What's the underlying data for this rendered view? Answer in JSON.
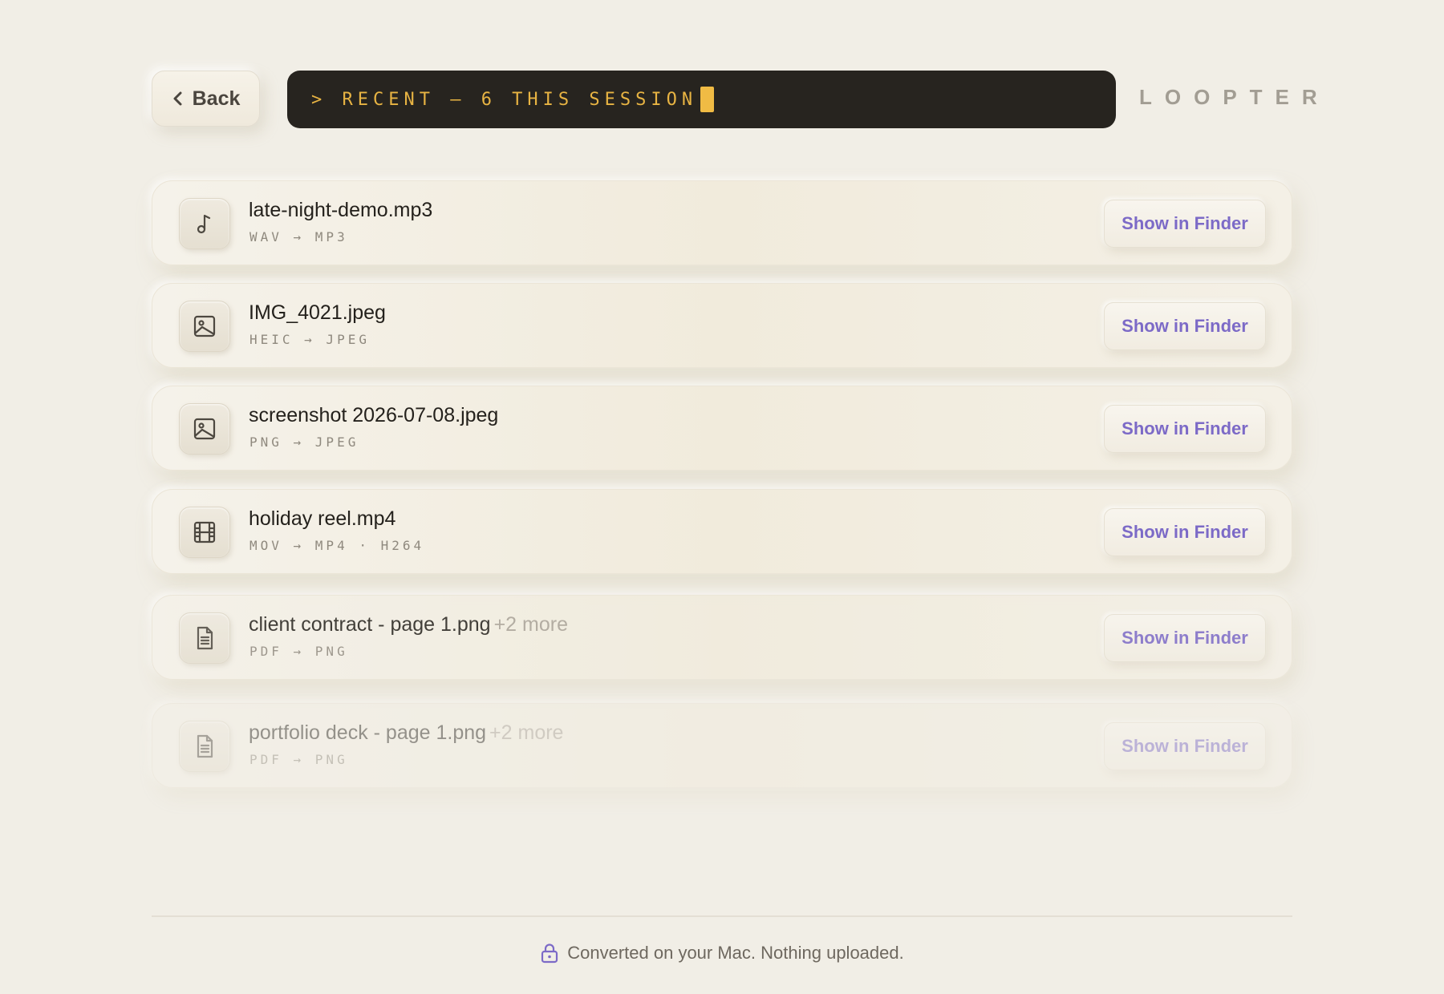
{
  "header": {
    "back_label": "Back",
    "terminal_text": "> RECENT — 6 THIS SESSION",
    "brand": "LOOPTER"
  },
  "files": [
    {
      "name": "late-night-demo.mp3",
      "more": "",
      "meta": "WAV → MP3",
      "icon": "music-note-icon",
      "action": "Show in Finder"
    },
    {
      "name": "IMG_4021.jpeg",
      "more": "",
      "meta": "HEIC → JPEG",
      "icon": "image-icon",
      "action": "Show in Finder"
    },
    {
      "name": "screenshot 2026-07-08.jpeg",
      "more": "",
      "meta": "PNG → JPEG",
      "icon": "image-icon",
      "action": "Show in Finder"
    },
    {
      "name": "holiday reel.mp4",
      "more": "",
      "meta": "MOV → MP4 · H264",
      "icon": "film-icon",
      "action": "Show in Finder"
    },
    {
      "name": "client contract - page 1.png",
      "more": "+2 more",
      "meta": "PDF → PNG",
      "icon": "document-icon",
      "action": "Show in Finder"
    },
    {
      "name": "portfolio deck - page 1.png",
      "more": "+2 more",
      "meta": "PDF → PNG",
      "icon": "document-icon",
      "action": "Show in Finder"
    }
  ],
  "footer": {
    "privacy_text": "Converted on your Mac. Nothing uploaded.",
    "icon": "lock-icon"
  },
  "colors": {
    "background": "#f1eee6",
    "terminal_bg": "#27241f",
    "terminal_text": "#e8b443",
    "accent": "#7c6ac7"
  }
}
